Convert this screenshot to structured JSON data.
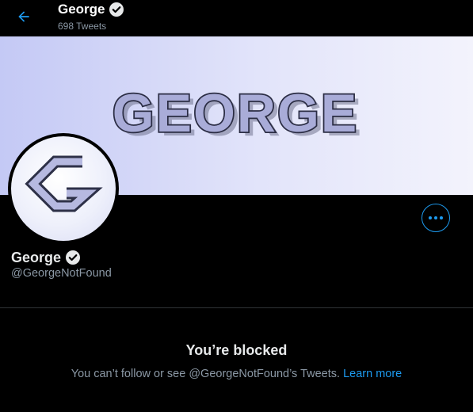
{
  "header": {
    "name": "George",
    "tweets_count": "698 Tweets"
  },
  "banner": {
    "text": "GEORGE"
  },
  "profile": {
    "name": "George",
    "handle": "@GeorgeNotFound"
  },
  "blocked": {
    "title": "You’re blocked",
    "message": "You can’t follow or see @GeorgeNotFound’s Tweets.",
    "link_label": "Learn more"
  },
  "colors": {
    "accent": "#1d9bf0",
    "background": "#000000",
    "secondary_text": "#8b98a5",
    "banner_text_fill": "#a9acd8"
  },
  "icons": [
    "back-arrow-icon",
    "verified-badge-icon",
    "more-options-icon"
  ]
}
